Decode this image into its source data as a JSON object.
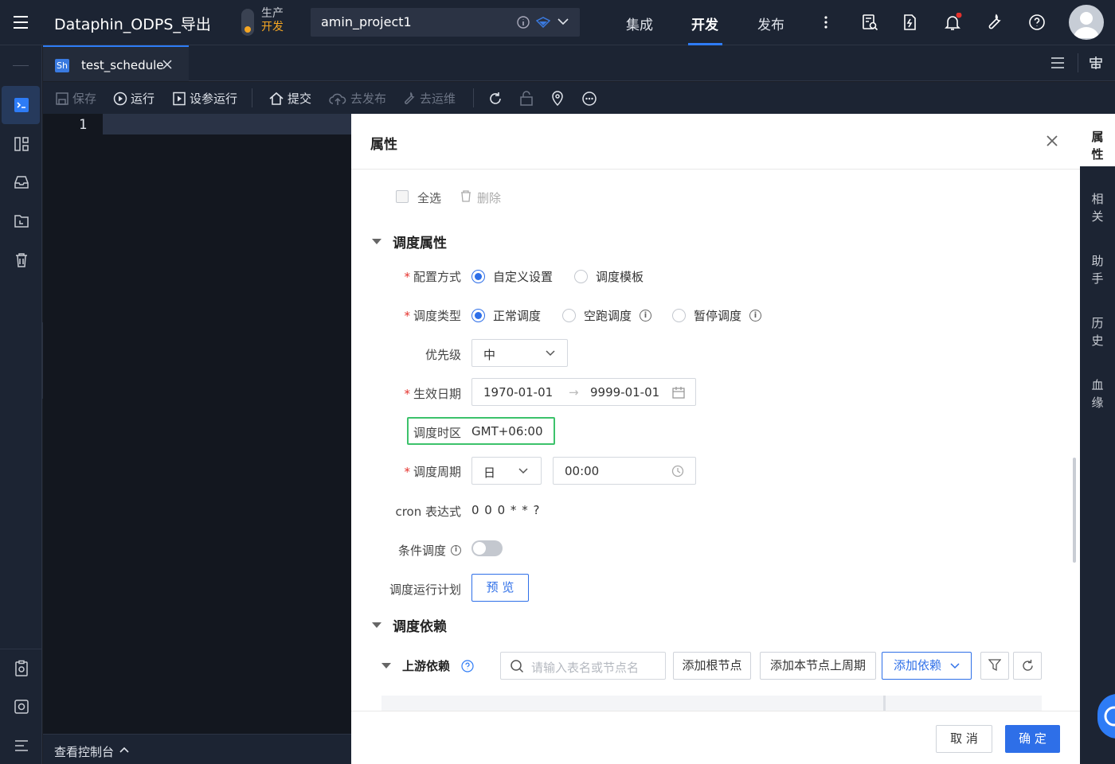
{
  "app": {
    "title": "Dataphin_ODPS_导出",
    "env_prod": "生产",
    "env_dev": "开发",
    "project": "amin_project1",
    "nav": [
      "集成",
      "开发",
      "发布"
    ],
    "active_nav": "开发",
    "notification_dot_color": "#e5322d",
    "accent": "#2e7cf6"
  },
  "tab": {
    "badge": "Sh",
    "name": "test_schedule"
  },
  "toolbar": {
    "save": "保存",
    "run": "运行",
    "run_params": "设参运行",
    "submit": "提交",
    "publish": "去发布",
    "ops": "去运维"
  },
  "editor": {
    "line_number": "1"
  },
  "console": {
    "label": "查看控制台"
  },
  "panel": {
    "title": "属性",
    "select_all": "全选",
    "delete": "删除",
    "schedule_section": "调度属性",
    "config_mode": {
      "label": "配置方式",
      "options": [
        "自定义设置",
        "调度模板"
      ],
      "selected": "自定义设置"
    },
    "schedule_type": {
      "label": "调度类型",
      "options": [
        "正常调度",
        "空跑调度",
        "暂停调度"
      ],
      "selected": "正常调度"
    },
    "priority": {
      "label": "优先级",
      "value": "中"
    },
    "effective_date": {
      "label": "生效日期",
      "start": "1970-01-01",
      "end": "9999-01-01"
    },
    "timezone": {
      "label": "调度时区",
      "value": "GMT+06:00"
    },
    "cycle": {
      "label": "调度周期",
      "unit": "日",
      "time": "00:00"
    },
    "cron": {
      "label": "cron 表达式",
      "value": "0 0 0 * * ?"
    },
    "condition": {
      "label": "条件调度",
      "enabled": false
    },
    "plan": {
      "label": "调度运行计划",
      "button": "预 览"
    },
    "dependency_section": "调度依赖",
    "upstream": {
      "label": "上游依赖",
      "search_placeholder": "请输入表名或节点名",
      "add_root": "添加根节点",
      "add_prev_cycle": "添加本节点上周期",
      "add_dep": "添加依赖"
    },
    "cancel": "取 消",
    "confirm": "确 定"
  },
  "right_rail": [
    [
      "属",
      "性"
    ],
    [
      "相",
      "关"
    ],
    [
      "助",
      "手"
    ],
    [
      "历",
      "史"
    ],
    [
      "血",
      "缘"
    ]
  ]
}
